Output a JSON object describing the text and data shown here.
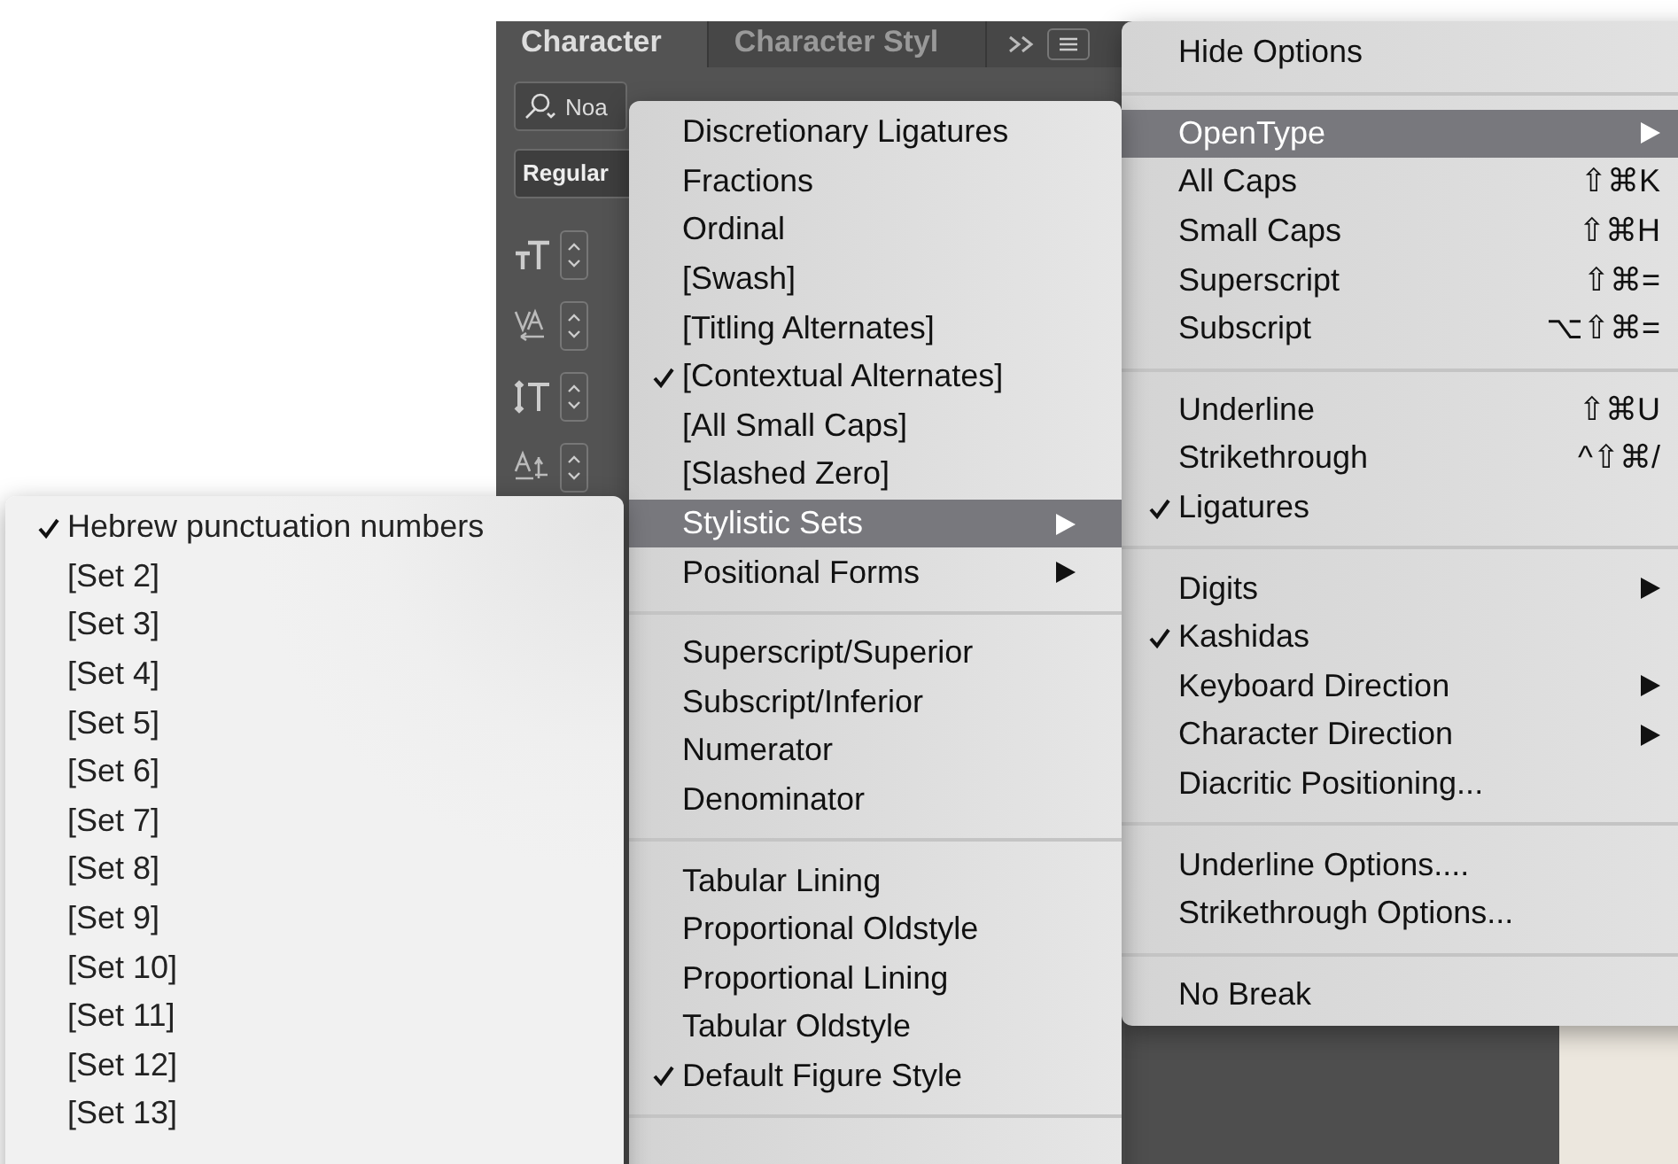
{
  "panel": {
    "tabs": [
      {
        "label": "Character",
        "selected": true
      },
      {
        "label": "Character Styl",
        "selected": false
      }
    ],
    "font_field": {
      "value": "Noa"
    },
    "style_field": {
      "value": "Regular"
    }
  },
  "panel_menu": {
    "items": [
      {
        "kind": "item",
        "label": "Hide Options",
        "selected": false,
        "checked": false
      },
      {
        "kind": "separator"
      },
      {
        "kind": "item",
        "label": "OpenType",
        "selected": true,
        "checked": false,
        "submenu": true
      },
      {
        "kind": "item",
        "label": "All Caps",
        "shortcut": "⇧⌘K",
        "selected": false,
        "checked": false
      },
      {
        "kind": "item",
        "label": "Small Caps",
        "shortcut": "⇧⌘H",
        "selected": false,
        "checked": false
      },
      {
        "kind": "item",
        "label": "Superscript",
        "shortcut": "⇧⌘=",
        "selected": false,
        "checked": false
      },
      {
        "kind": "item",
        "label": "Subscript",
        "shortcut": "⌥⇧⌘=",
        "selected": false,
        "checked": false
      },
      {
        "kind": "separator"
      },
      {
        "kind": "item",
        "label": "Underline",
        "shortcut": "⇧⌘U",
        "selected": false,
        "checked": false
      },
      {
        "kind": "item",
        "label": "Strikethrough",
        "shortcut": "^⇧⌘/",
        "selected": false,
        "checked": false
      },
      {
        "kind": "item",
        "label": "Ligatures",
        "selected": false,
        "checked": true
      },
      {
        "kind": "separator"
      },
      {
        "kind": "item",
        "label": "Digits",
        "selected": false,
        "checked": false,
        "submenu": true
      },
      {
        "kind": "item",
        "label": "Kashidas",
        "selected": false,
        "checked": true
      },
      {
        "kind": "item",
        "label": "Keyboard Direction",
        "selected": false,
        "checked": false,
        "submenu": true
      },
      {
        "kind": "item",
        "label": "Character Direction",
        "selected": false,
        "checked": false,
        "submenu": true
      },
      {
        "kind": "item",
        "label": "Diacritic Positioning...",
        "selected": false,
        "checked": false
      },
      {
        "kind": "separator"
      },
      {
        "kind": "item",
        "label": "Underline Options....",
        "selected": false,
        "checked": false
      },
      {
        "kind": "item",
        "label": "Strikethrough Options...",
        "selected": false,
        "checked": false
      },
      {
        "kind": "separator"
      },
      {
        "kind": "item",
        "label": "No Break",
        "selected": false,
        "checked": false
      }
    ]
  },
  "opentype_menu": {
    "items": [
      {
        "kind": "item",
        "label": "Discretionary Ligatures",
        "selected": false,
        "checked": false
      },
      {
        "kind": "item",
        "label": "Fractions",
        "selected": false,
        "checked": false
      },
      {
        "kind": "item",
        "label": "Ordinal",
        "selected": false,
        "checked": false
      },
      {
        "kind": "item",
        "label": "[Swash]",
        "selected": false,
        "checked": false
      },
      {
        "kind": "item",
        "label": "[Titling Alternates]",
        "selected": false,
        "checked": false
      },
      {
        "kind": "item",
        "label": "[Contextual Alternates]",
        "selected": false,
        "checked": true
      },
      {
        "kind": "item",
        "label": "[All Small Caps]",
        "selected": false,
        "checked": false
      },
      {
        "kind": "item",
        "label": "[Slashed Zero]",
        "selected": false,
        "checked": false
      },
      {
        "kind": "item",
        "label": "Stylistic Sets",
        "selected": true,
        "checked": false,
        "submenu": true
      },
      {
        "kind": "item",
        "label": "Positional Forms",
        "selected": false,
        "checked": false,
        "submenu": true
      },
      {
        "kind": "separator"
      },
      {
        "kind": "item",
        "label": "Superscript/Superior",
        "selected": false,
        "checked": false
      },
      {
        "kind": "item",
        "label": "Subscript/Inferior",
        "selected": false,
        "checked": false
      },
      {
        "kind": "item",
        "label": "Numerator",
        "selected": false,
        "checked": false
      },
      {
        "kind": "item",
        "label": "Denominator",
        "selected": false,
        "checked": false
      },
      {
        "kind": "separator"
      },
      {
        "kind": "item",
        "label": "Tabular Lining",
        "selected": false,
        "checked": false
      },
      {
        "kind": "item",
        "label": "Proportional Oldstyle",
        "selected": false,
        "checked": false
      },
      {
        "kind": "item",
        "label": "Proportional Lining",
        "selected": false,
        "checked": false
      },
      {
        "kind": "item",
        "label": "Tabular Oldstyle",
        "selected": false,
        "checked": false
      },
      {
        "kind": "item",
        "label": "Default Figure Style",
        "selected": false,
        "checked": true
      },
      {
        "kind": "separator"
      }
    ]
  },
  "stylistic_sets_menu": {
    "items": [
      {
        "kind": "item",
        "label": "Hebrew punctuation  numbers",
        "selected": false,
        "checked": true
      },
      {
        "kind": "item",
        "label": "[Set 2]",
        "selected": false,
        "checked": false
      },
      {
        "kind": "item",
        "label": "[Set 3]",
        "selected": false,
        "checked": false
      },
      {
        "kind": "item",
        "label": "[Set 4]",
        "selected": false,
        "checked": false
      },
      {
        "kind": "item",
        "label": "[Set 5]",
        "selected": false,
        "checked": false
      },
      {
        "kind": "item",
        "label": "[Set 6]",
        "selected": false,
        "checked": false
      },
      {
        "kind": "item",
        "label": "[Set 7]",
        "selected": false,
        "checked": false
      },
      {
        "kind": "item",
        "label": "[Set 8]",
        "selected": false,
        "checked": false
      },
      {
        "kind": "item",
        "label": "[Set 9]",
        "selected": false,
        "checked": false
      },
      {
        "kind": "item",
        "label": "[Set 10]",
        "selected": false,
        "checked": false
      },
      {
        "kind": "item",
        "label": "[Set 11]",
        "selected": false,
        "checked": false
      },
      {
        "kind": "item",
        "label": "[Set 12]",
        "selected": false,
        "checked": false
      },
      {
        "kind": "item",
        "label": "[Set 13]",
        "selected": false,
        "checked": false
      }
    ]
  }
}
